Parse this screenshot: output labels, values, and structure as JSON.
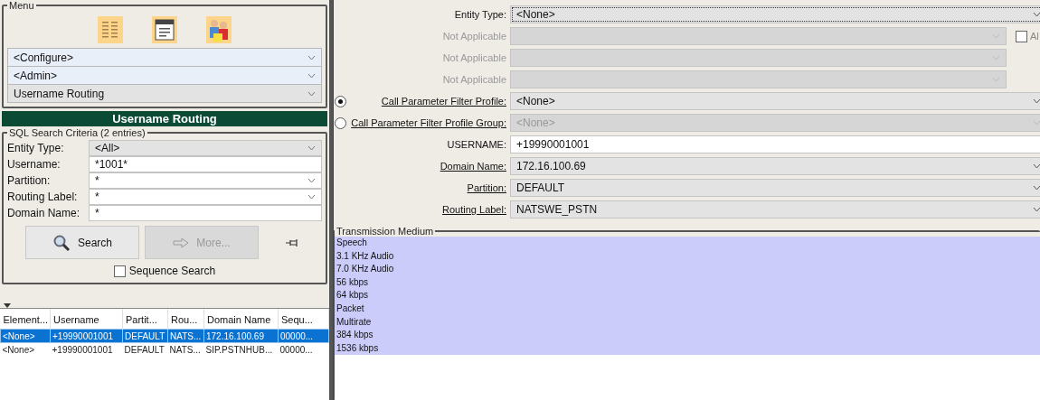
{
  "menu": {
    "title": "Menu",
    "dropdowns": [
      {
        "value": "<Configure>",
        "highlighted": true
      },
      {
        "value": "<Admin>",
        "highlighted": true
      },
      {
        "value": "Username Routing",
        "highlighted": false
      }
    ]
  },
  "search_panel": {
    "title": "Username Routing",
    "criteria_title": "SQL Search Criteria (2 entries)",
    "fields": [
      {
        "label": "Entity Type:",
        "value": "<All>",
        "kind": "select",
        "disabled": true
      },
      {
        "label": "Username:",
        "value": "*1001*",
        "kind": "text",
        "disabled": false
      },
      {
        "label": "Partition:",
        "value": "*",
        "kind": "select",
        "disabled": false
      },
      {
        "label": "Routing Label:",
        "value": "*",
        "kind": "select",
        "disabled": false
      },
      {
        "label": "Domain Name:",
        "value": "*",
        "kind": "text",
        "disabled": false
      }
    ],
    "buttons": [
      {
        "label": "Search",
        "disabled": false
      },
      {
        "label": "More...",
        "disabled": true
      }
    ],
    "sequence_search": {
      "label": "Sequence Search",
      "checked": false
    }
  },
  "results": {
    "columns": [
      "Element...",
      "Username",
      "Partit...",
      "Rou...",
      "Domain Name",
      "Sequ..."
    ],
    "rows": [
      {
        "cells": [
          "<None>",
          "+19990001001",
          "DEFAULT",
          "NATS...",
          "172.16.100.69",
          "00000..."
        ],
        "selected": true
      },
      {
        "cells": [
          "<None>",
          "+19990001001",
          "DEFAULT",
          "NATS...",
          "SIP.PSTNHUB...",
          "00000..."
        ],
        "selected": false
      }
    ]
  },
  "detail": {
    "rows": [
      {
        "label": "Entity Type:",
        "value": "<None>",
        "kind": "select",
        "disabled": false,
        "focused": true,
        "underlined": false
      },
      {
        "label": "Not Applicable",
        "value": "",
        "kind": "select",
        "disabled": true,
        "focused": false,
        "underlined": false,
        "checkbox": {
          "label": "Al",
          "checked": false
        }
      },
      {
        "label": "Not Applicable",
        "value": "",
        "kind": "select",
        "disabled": true,
        "focused": false,
        "underlined": false
      },
      {
        "label": "Not Applicable",
        "value": "",
        "kind": "select",
        "disabled": true,
        "focused": false,
        "underlined": false
      },
      {
        "label": "Call Parameter Filter Profile:",
        "value": "<None>",
        "kind": "select",
        "disabled": false,
        "focused": false,
        "underlined": true,
        "radio": {
          "selected": true
        }
      },
      {
        "label": "Call Parameter Filter Profile Group:",
        "value": "<None>",
        "kind": "select",
        "disabled": true,
        "focused": false,
        "underlined": true,
        "radio": {
          "selected": false
        }
      },
      {
        "label": "USERNAME:",
        "value": "+19990001001",
        "kind": "text",
        "disabled": false,
        "focused": false,
        "underlined": false
      },
      {
        "label": "Domain Name:",
        "value": "172.16.100.69",
        "kind": "select",
        "disabled": false,
        "focused": false,
        "underlined": true
      },
      {
        "label": "Partition:",
        "value": "DEFAULT",
        "kind": "select",
        "disabled": false,
        "focused": false,
        "underlined": true
      },
      {
        "label": "Routing Label:",
        "value": "NATSWE_PSTN",
        "kind": "select",
        "disabled": false,
        "focused": false,
        "underlined": true
      }
    ],
    "transmission_medium": {
      "title": "Transmission Medium",
      "items": [
        {
          "label": "Speech",
          "selected": true
        },
        {
          "label": "3.1 KHz Audio",
          "selected": true
        },
        {
          "label": "7.0 KHz Audio",
          "selected": true
        },
        {
          "label": "56 kbps",
          "selected": true
        },
        {
          "label": "64 kbps",
          "selected": true
        },
        {
          "label": "Packet",
          "selected": true
        },
        {
          "label": "Multirate",
          "selected": true
        },
        {
          "label": "384 kbps",
          "selected": true
        },
        {
          "label": "1536 kbps",
          "selected": true
        }
      ]
    }
  }
}
